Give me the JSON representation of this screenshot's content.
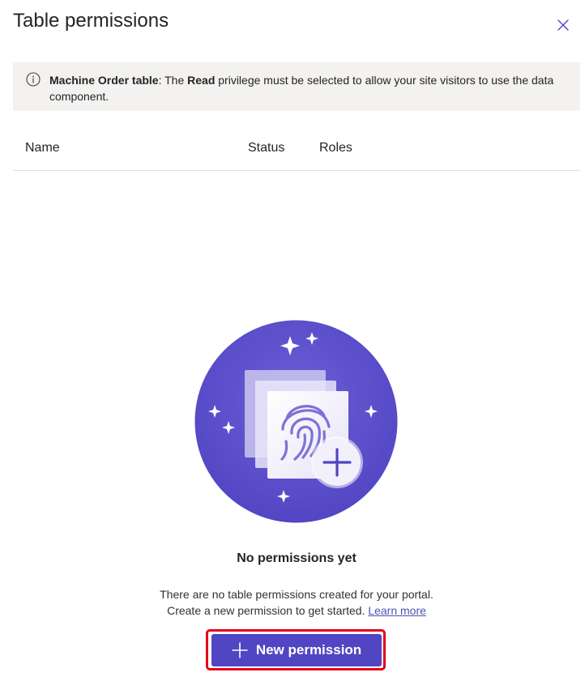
{
  "panel": {
    "title": "Table permissions",
    "close_icon": "close-icon"
  },
  "info": {
    "icon": "info-icon",
    "table_name": "Machine Order table",
    "text_before": ": The ",
    "privilege": "Read",
    "text_after": " privilege must be selected to allow your site visitors to use the data component."
  },
  "table": {
    "columns": [
      "Name",
      "Status",
      "Roles"
    ]
  },
  "empty_state": {
    "illustration_icon": "fingerprint-plus-illustration",
    "title": "No permissions yet",
    "line1": "There are no table permissions created for your portal.",
    "line2": "Create a new permission to get started.",
    "learn_more": "Learn more"
  },
  "actions": {
    "new_permission_label": "New permission",
    "new_permission_icon": "plus-icon"
  },
  "colors": {
    "accent": "#5045c2",
    "illustration_bg": "#5b50c9",
    "highlight": "#e3001b",
    "link": "#4f52b2",
    "infobar_bg": "#f3f2f1"
  }
}
